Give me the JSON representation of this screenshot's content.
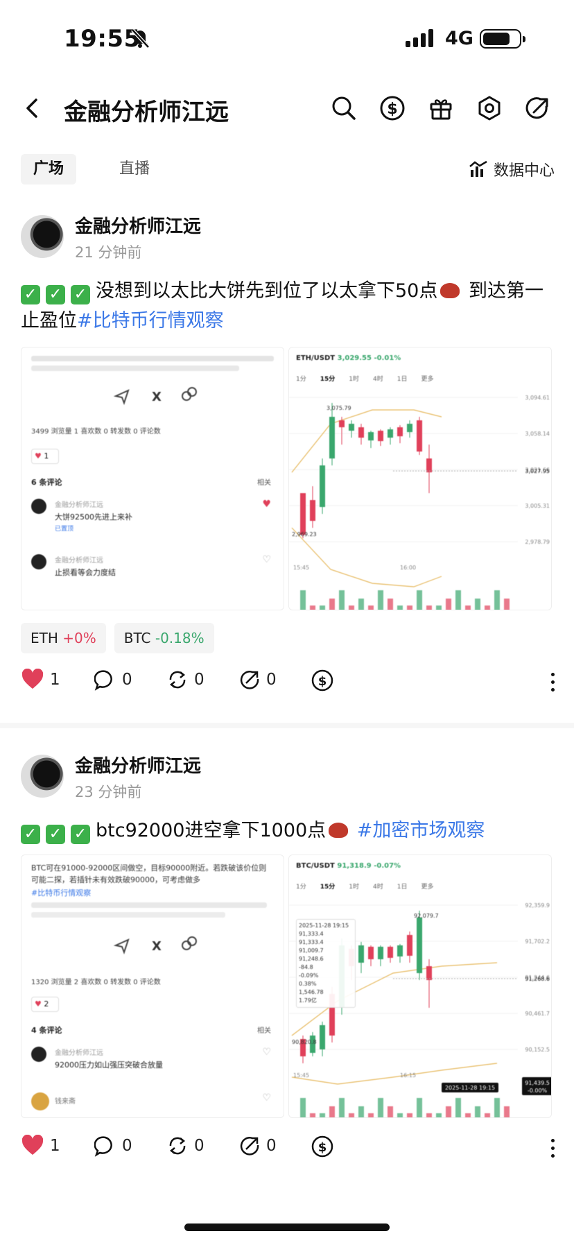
{
  "status_bar": {
    "time": "19:55",
    "network": "4G",
    "battery_level": 0.75
  },
  "nav": {
    "title": "金融分析师江远",
    "icons": [
      "back-icon",
      "search-icon",
      "dollar-icon",
      "gift-icon",
      "settings-icon",
      "share-icon"
    ]
  },
  "tabs": {
    "items": [
      {
        "label": "广场",
        "active": true
      },
      {
        "label": "直播",
        "active": false
      }
    ],
    "data_center": "数据中心"
  },
  "posts": [
    {
      "author": "金融分析师江远",
      "time": "21 分钟前",
      "text": "没想到以太比大饼先到位了以太拿下50点",
      "text2": "到达第一止盈位",
      "hashtag": "#比特币行情观察",
      "left_image": {
        "stats": "3499 浏览量  1 喜欢数  0 转发数  0 评论数",
        "likes": "1",
        "comments_header": "6 条评论",
        "sort": "相关",
        "comments": [
          {
            "name": "金融分析师江远",
            "text": "大饼92500先进上来补",
            "meta": "已置顶"
          },
          {
            "name": "金融分析师江远",
            "text": "止损看等会力度结",
            "meta": ""
          }
        ]
      },
      "right_image": {
        "pair": "ETH/USDT",
        "price": "3,029.55",
        "change": "-0.01%",
        "intervals": [
          "1分",
          "15分",
          "1时",
          "4时",
          "1日",
          "更多"
        ],
        "high_label": "3,075.79",
        "low_label": "2,969.23",
        "current_label": "3,027.95",
        "y_ticks": [
          "3,094.61",
          "3,058.14",
          "3,021.66",
          "3,005.31",
          "2,978.79"
        ],
        "x_ticks": [
          "15:45",
          "16:00"
        ]
      },
      "chips": [
        {
          "sym": "ETH",
          "chg": "+0%",
          "dir": "pos"
        },
        {
          "sym": "BTC",
          "chg": "-0.18%",
          "dir": "neg"
        }
      ],
      "actions": {
        "likes": "1",
        "comments": "0",
        "reposts": "0",
        "shares": "0"
      }
    },
    {
      "author": "金融分析师江远",
      "time": "23 分钟前",
      "text": "btc92000进空拿下1000点",
      "hashtag": "#加密市场观察",
      "left_image": {
        "body": "BTC可在91000-92000区间做空，目标90000附近。若跌破该价位则可能二探，若插针未有效跌破90000，可考虑做多",
        "hashtag": "#比特币行情观察",
        "stats": "1320 浏览量  2 喜欢数  0 转发数  0 评论数",
        "likes": "2",
        "comments_header": "4 条评论",
        "sort": "相关",
        "comments": [
          {
            "name": "金融分析师江远",
            "text": "92000压力如山强压突破合放量",
            "meta": ""
          },
          {
            "name": "钱来斋",
            "text": "",
            "meta": ""
          }
        ]
      },
      "right_image": {
        "pair": "BTC/USDT",
        "price": "91,318.9",
        "change": "-0.07%",
        "intervals": [
          "1分",
          "15分",
          "1时",
          "4时",
          "1日",
          "更多"
        ],
        "tooltip": [
          "2025-11-28 19:15",
          "91,333.4",
          "91,333.4",
          "91,009.7",
          "91,248.6",
          "-84.8",
          "-0.09%",
          "0.38%",
          "1,546.78",
          "1.79亿"
        ],
        "high_label": "92,079.7",
        "low_label": "90,820.8",
        "current_label": "91,268.6",
        "badge": "91,439.5",
        "badge_pct": "-0.00%",
        "date_badge": "2025-11-28 19:15",
        "y_ticks": [
          "92,359.9",
          "91,702.2",
          "91,244.6",
          "90,461.7",
          "90,152.5"
        ],
        "x_ticks": [
          "15:45",
          "16:15"
        ]
      },
      "actions": {
        "likes": "1",
        "comments": "0",
        "reposts": "0",
        "shares": "0"
      }
    }
  ],
  "colors": {
    "accent": "#3b78e7",
    "up": "#3aa76d",
    "down": "#e0405a",
    "heart": "#e0405a"
  }
}
